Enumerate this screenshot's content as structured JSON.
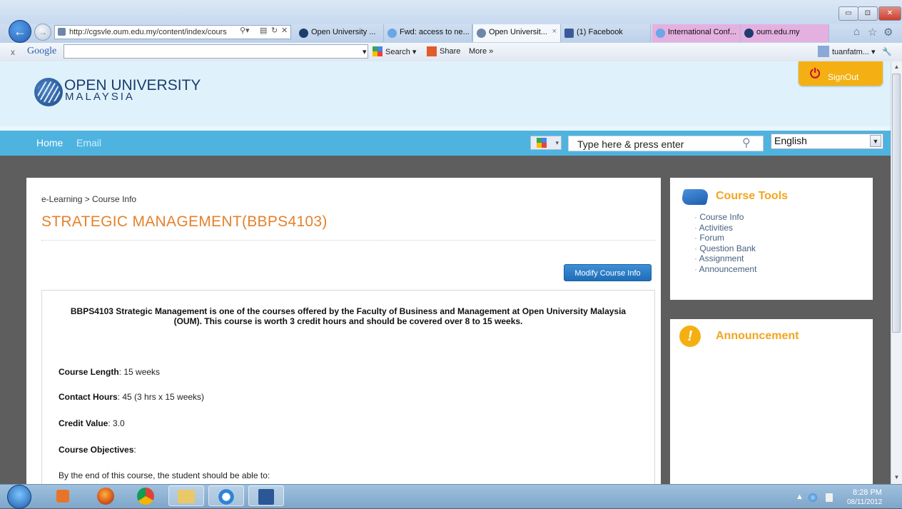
{
  "browser": {
    "url": "http://cgsvle.oum.edu.my/content/index/cours",
    "tabs": [
      {
        "label": "Open University ..."
      },
      {
        "label": "Fwd: access to ne..."
      },
      {
        "label": "Open Universit..."
      },
      {
        "label": "(1) Facebook"
      },
      {
        "label": "International Conf..."
      },
      {
        "label": "oum.edu.my"
      }
    ],
    "tab_close": "×",
    "window_controls": {
      "minimize": "▭",
      "maximize": "⊡",
      "close": "✕"
    },
    "right_icons": [
      "⌂",
      "☆",
      "⚙"
    ]
  },
  "google_toolbar": {
    "close": "x",
    "logo": "Google",
    "search_label": "Search",
    "share_label": "Share",
    "more_label": "More »",
    "user": "tuanfatm...",
    "wrench": "🔧"
  },
  "site": {
    "logo_line1": "OPEN UNIVERSITY",
    "logo_line2": "MALAYSIA",
    "signout_label": "SignOut",
    "signout_icon": "⏻",
    "nav": {
      "home": "Home",
      "email": "Email"
    },
    "search_placeholder": "Type here & press enter",
    "search_icon": "⚲",
    "language": "English",
    "lang_arrow": "▼"
  },
  "main": {
    "breadcrumb": "e-Learning > Course Info",
    "title": "STRATEGIC MANAGEMENT(BBPS4103)",
    "modify_button": "Modify Course Info",
    "intro": "BBPS4103 Strategic Management is one of the courses offered by the Faculty of Business and Management at Open University Malaysia (OUM). This course is worth 3 credit hours and should be covered over 8 to 15 weeks.",
    "details": [
      {
        "label": "Course Length",
        "value": ": 15 weeks"
      },
      {
        "label": "Contact Hours",
        "value": ": 45 (3 hrs x 15 weeks)"
      },
      {
        "label": "Credit Value",
        "value": ": 3.0"
      },
      {
        "label": "Course Objectives",
        "value": ":"
      }
    ],
    "objectives_intro": "By the end of this course, the student should be able to:"
  },
  "sidebar": {
    "tools_title": "Course Tools",
    "tools": [
      "Course Info",
      "Activities",
      "Forum",
      "Question Bank",
      "Assignment",
      "Announcement"
    ],
    "announcement_title": "Announcement",
    "announcement_icon": "!"
  },
  "taskbar": {
    "time": "8:28 PM",
    "date": "08/11/2012",
    "tray_arrow": "▲"
  },
  "colors": {
    "accent_orange": "#e5812c",
    "nav_blue": "#4fb3e0",
    "signout_yellow": "#f4b012",
    "header_bg": "#dff2fb"
  }
}
